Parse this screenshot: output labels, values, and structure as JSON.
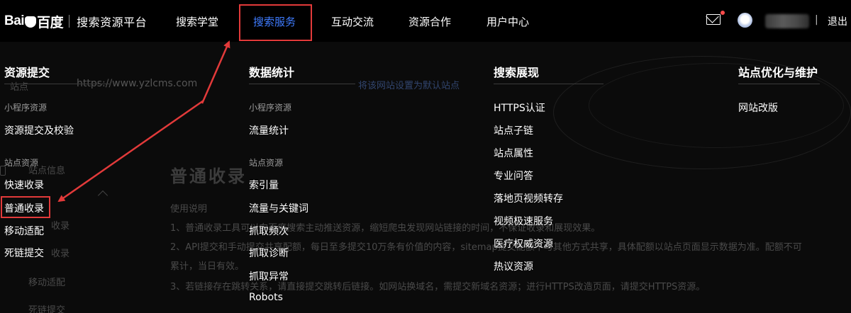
{
  "brand": {
    "logo_text_left": "Bai",
    "logo_text_right": "百度",
    "platform_name": "搜索资源平台"
  },
  "nav": [
    {
      "label": "搜索学堂"
    },
    {
      "label": "搜索服务",
      "active": true
    },
    {
      "label": "互动交流"
    },
    {
      "label": "资源合作"
    },
    {
      "label": "用户中心"
    }
  ],
  "header_right": {
    "mail_icon": "mail-icon",
    "has_unread": true,
    "separator": "|",
    "logout_label": "退出"
  },
  "menu": {
    "columns": [
      {
        "title": "资源提交",
        "groups": [
          {
            "label": "小程序资源",
            "items": [
              "资源提交及校验"
            ]
          },
          {
            "label": "站点资源",
            "items": [
              "快速收录",
              "普通收录",
              "移动适配",
              "死链提交"
            ]
          }
        ]
      },
      {
        "title": "数据统计",
        "groups": [
          {
            "label": "小程序资源",
            "items": [
              "流量统计"
            ]
          },
          {
            "label": "站点资源",
            "items": [
              "索引量",
              "流量与关键词",
              "抓取频次",
              "抓取诊断",
              "抓取异常",
              "Robots"
            ]
          }
        ]
      },
      {
        "title": "搜索展现",
        "groups": [
          {
            "label": "",
            "items": [
              "HTTPS认证",
              "站点子链",
              "站点属性",
              "专业问答",
              "落地页视频转存",
              "视频极速服务",
              "医疗权威资源",
              "热议资源"
            ]
          }
        ]
      },
      {
        "title": "站点优化与维护",
        "groups": [
          {
            "label": "",
            "items": [
              "网站改版"
            ]
          }
        ]
      }
    ]
  },
  "background_page": {
    "site_label": "站点",
    "site_url": "https://www.yzlcms.com",
    "set_default_link": "将该网站设置为默认站点",
    "sidebar_site_info": "站点信息",
    "sidebar_items": [
      "收录",
      "收录",
      "移动适配",
      "死链提交"
    ],
    "page_title": "普通收录",
    "usage_label": "使用说明",
    "usage_lines": [
      "1、普通收录工具可以向百度搜索主动推送资源，缩短爬虫发现网站链接的时间，不保证收录和展现效果。",
      "2、API提交和手动提交共享配额，每日至多提交10万条有价值的内容，sitemap提交配额不与其他方式共享，具体配额以站点页面显示数据为准。配额不可",
      "累计，当日有效。",
      "3、若链接存在跳转关系，请直接提交跳转后链接。如网站换域名，需提交新域名资源；进行HTTPS改造页面，请提交HTTPS资源。"
    ]
  },
  "annotation": {
    "highlight_color": "#e23a3a",
    "accent": "#3f7cff"
  }
}
